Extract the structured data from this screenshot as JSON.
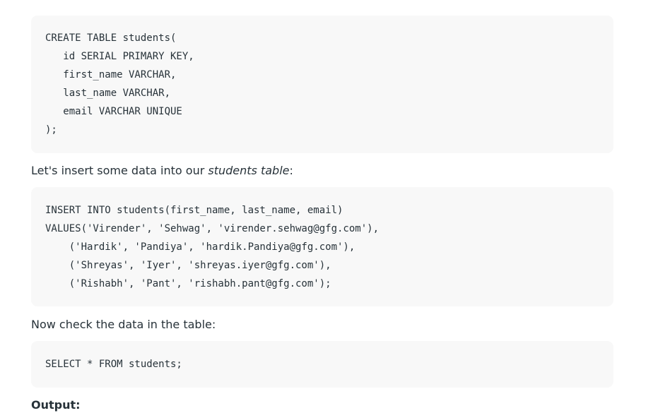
{
  "create_block": {
    "lines": [
      "CREATE TABLE students(",
      "   id SERIAL PRIMARY KEY,",
      "   first_name VARCHAR,",
      "   last_name VARCHAR,",
      "   email VARCHAR UNIQUE",
      ");"
    ]
  },
  "insert_intro": {
    "before": "Let's insert some data into our ",
    "emphasis": "students table",
    "after": ":"
  },
  "insert_block": {
    "lines": [
      "INSERT INTO students(first_name, last_name, email)",
      "VALUES('Virender', 'Sehwag', 'virender.sehwag@gfg.com'),",
      "    ('Hardik', 'Pandiya', 'hardik.Pandiya@gfg.com'),",
      "    ('Shreyas', 'Iyer', 'shreyas.iyer@gfg.com'),",
      "    ('Rishabh', 'Pant', 'rishabh.pant@gfg.com');"
    ]
  },
  "check_intro": {
    "text": "Now check the data in the table:"
  },
  "select_block": {
    "lines": [
      "SELECT * FROM students;"
    ]
  },
  "output_label": {
    "text": "Output:"
  }
}
